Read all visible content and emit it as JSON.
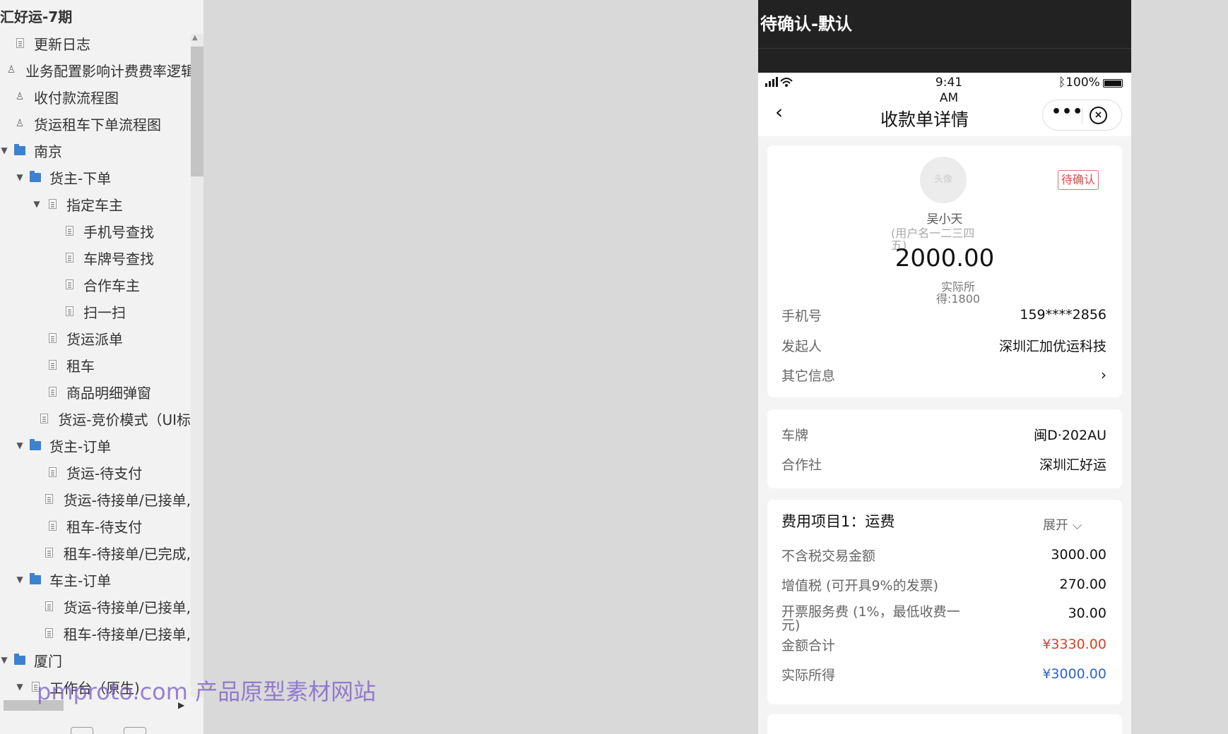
{
  "sidebar": {
    "title": "汇好运-7期",
    "items": [
      {
        "label": "更新日志",
        "type": "doc",
        "indent": 0,
        "arrow": ""
      },
      {
        "label": "业务配置影响计费费率逻辑",
        "type": "flow",
        "indent": 0,
        "arrow": ""
      },
      {
        "label": "收付款流程图",
        "type": "flow",
        "indent": 0,
        "arrow": ""
      },
      {
        "label": "货运租车下单流程图",
        "type": "flow",
        "indent": 0,
        "arrow": ""
      },
      {
        "label": "南京",
        "type": "folder",
        "indent": 0,
        "arrow": "▼"
      },
      {
        "label": "货主-下单",
        "type": "folder",
        "indent": 1,
        "arrow": "▼"
      },
      {
        "label": "指定车主",
        "type": "doc",
        "indent": 2,
        "arrow": "▼"
      },
      {
        "label": "手机号查找",
        "type": "doc",
        "indent": 3,
        "arrow": ""
      },
      {
        "label": "车牌号查找",
        "type": "doc",
        "indent": 3,
        "arrow": ""
      },
      {
        "label": "合作车主",
        "type": "doc",
        "indent": 3,
        "arrow": ""
      },
      {
        "label": "扫一扫",
        "type": "doc",
        "indent": 3,
        "arrow": ""
      },
      {
        "label": "货运派单",
        "type": "doc",
        "indent": 2,
        "arrow": ""
      },
      {
        "label": "租车",
        "type": "doc",
        "indent": 2,
        "arrow": ""
      },
      {
        "label": "商品明细弹窗",
        "type": "doc",
        "indent": 2,
        "arrow": ""
      },
      {
        "label": "货运-竞价模式（UI标",
        "type": "doc",
        "indent": 2,
        "arrow": ""
      },
      {
        "label": "货主-订单",
        "type": "folder",
        "indent": 1,
        "arrow": "▼"
      },
      {
        "label": "货运-待支付",
        "type": "doc",
        "indent": 2,
        "arrow": ""
      },
      {
        "label": "货运-待接单/已接单,",
        "type": "doc",
        "indent": 2,
        "arrow": ""
      },
      {
        "label": "租车-待支付",
        "type": "doc",
        "indent": 2,
        "arrow": ""
      },
      {
        "label": "租车-待接单/已完成,",
        "type": "doc",
        "indent": 2,
        "arrow": ""
      },
      {
        "label": "车主-订单",
        "type": "folder",
        "indent": 1,
        "arrow": "▼"
      },
      {
        "label": "货运-待接单/已接单,",
        "type": "doc",
        "indent": 2,
        "arrow": ""
      },
      {
        "label": "租车-待接单/已接单,",
        "type": "doc",
        "indent": 2,
        "arrow": ""
      },
      {
        "label": "厦门",
        "type": "folder",
        "indent": 0,
        "arrow": "▼"
      },
      {
        "label": "工作台（原生)",
        "type": "doc",
        "indent": 1,
        "arrow": "▼"
      }
    ]
  },
  "watermark": "pmproto.com 产品原型素材网站",
  "panel": {
    "title": "待确认-默认",
    "status": {
      "time": "9:41\nAM",
      "battery": "100%"
    },
    "nav_title": "收款单详情",
    "more": "•••",
    "close": "×",
    "back": "‹",
    "card1": {
      "avatar": "头像",
      "badge": "待确认",
      "name": "吴小天",
      "username": "(用户名一二三四五)",
      "amount": "2000.00",
      "actual": "实际所得:1800",
      "rows": [
        {
          "k": "手机号",
          "v": "159****2856"
        },
        {
          "k": "发起人",
          "v": "深圳汇加优运科技"
        },
        {
          "k": "其它信息",
          "v": "›"
        }
      ]
    },
    "card2": {
      "rows": [
        {
          "k": "车牌",
          "v": "闽D·202AU"
        },
        {
          "k": "合作社",
          "v": "深圳汇好运"
        }
      ]
    },
    "card3": {
      "title": "费用项目1：运费",
      "expand": "展开 ⌵",
      "rows": [
        {
          "k": "不含税交易金额",
          "v": "3000.00"
        },
        {
          "k": "增值税 (可开具9%的发票)",
          "v": "270.00"
        },
        {
          "k": "开票服务费 (1%，最低收费一元)",
          "v": "30.00"
        },
        {
          "k": "金额合计",
          "v": "¥3330.00"
        },
        {
          "k": "实际所得",
          "v": "¥3000.00"
        }
      ]
    },
    "colors": {
      "red": "#d9401e",
      "blue": "#2f64c9",
      "header": "#222222"
    }
  }
}
